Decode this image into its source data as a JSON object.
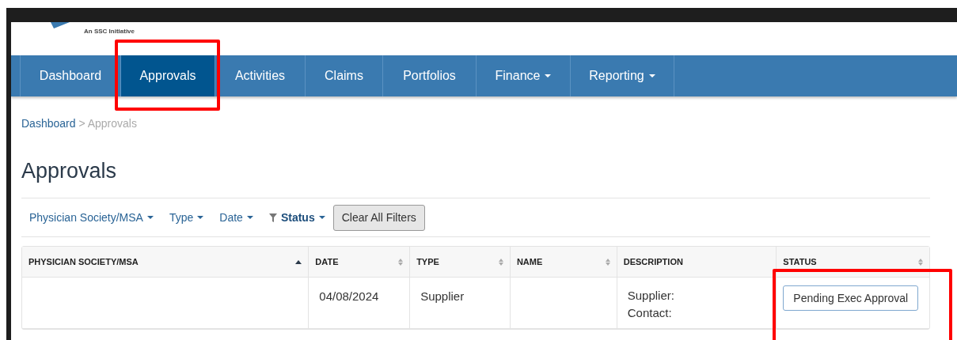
{
  "header": {
    "tagline": "An SSC Initiative"
  },
  "nav": [
    {
      "label": "Dashboard",
      "selected": false,
      "dropdown": false
    },
    {
      "label": "Approvals",
      "selected": true,
      "dropdown": false
    },
    {
      "label": "Activities",
      "selected": false,
      "dropdown": false
    },
    {
      "label": "Claims",
      "selected": false,
      "dropdown": false
    },
    {
      "label": "Portfolios",
      "selected": false,
      "dropdown": false
    },
    {
      "label": "Finance",
      "selected": false,
      "dropdown": true
    },
    {
      "label": "Reporting",
      "selected": false,
      "dropdown": true
    }
  ],
  "breadcrumb": {
    "link": "Dashboard",
    "separator": ">",
    "current": "Approvals"
  },
  "page_title": "Approvals",
  "filters": [
    {
      "label": "Physician Society/MSA",
      "active": false
    },
    {
      "label": "Type",
      "active": false
    },
    {
      "label": "Date",
      "active": false
    },
    {
      "label": "Status",
      "active": true
    }
  ],
  "clear_button": "Clear All Filters",
  "table": {
    "columns": [
      {
        "label": "PHYSICIAN SOCIETY/MSA",
        "sortable": true,
        "sorted": true
      },
      {
        "label": "DATE",
        "sortable": true,
        "sorted": false
      },
      {
        "label": "TYPE",
        "sortable": true,
        "sorted": false
      },
      {
        "label": "NAME",
        "sortable": true,
        "sorted": false
      },
      {
        "label": "DESCRIPTION",
        "sortable": false
      },
      {
        "label": "STATUS",
        "sortable": true,
        "sorted": false
      }
    ],
    "rows": [
      {
        "date": "04/08/2024",
        "type": "Supplier",
        "description": [
          "Supplier:",
          "Contact:"
        ],
        "status": "Pending Exec Approval"
      }
    ]
  }
}
